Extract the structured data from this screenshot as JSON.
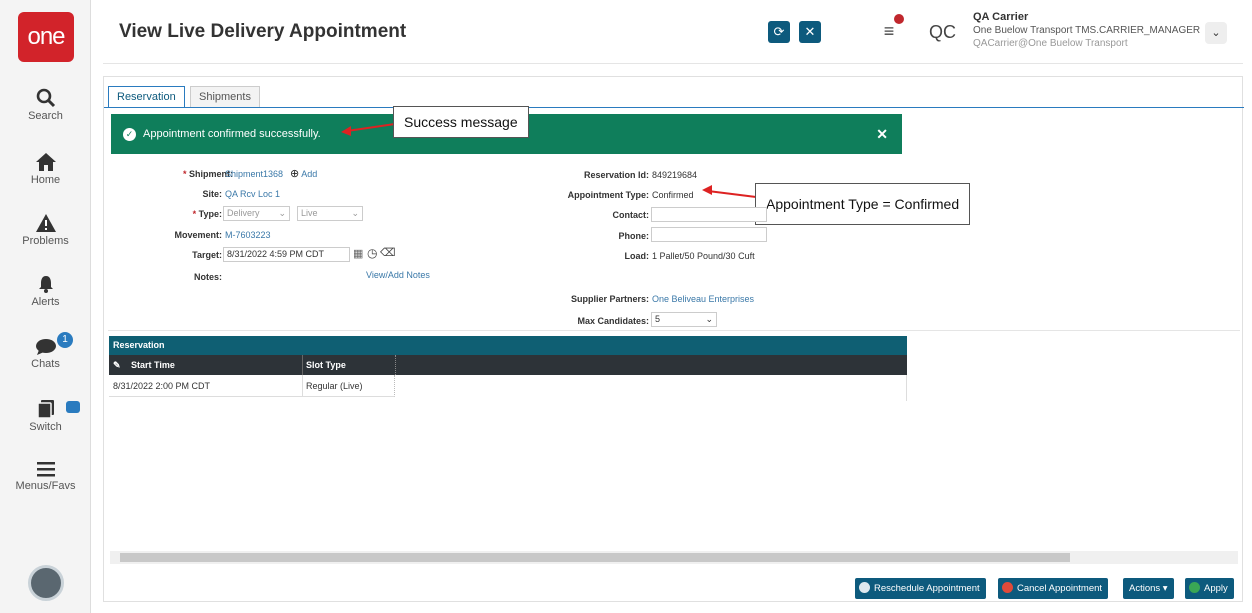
{
  "sidebar": {
    "logo": "one",
    "items": [
      {
        "label": "Search",
        "icon": "search-icon"
      },
      {
        "label": "Home",
        "icon": "home-icon"
      },
      {
        "label": "Problems",
        "icon": "warning-icon"
      },
      {
        "label": "Alerts",
        "icon": "bell-icon"
      },
      {
        "label": "Chats",
        "icon": "chat-icon",
        "badge": "1"
      },
      {
        "label": "Switch",
        "icon": "switch-icon"
      },
      {
        "label": "Menus/Favs",
        "icon": "menu-icon"
      }
    ]
  },
  "header": {
    "title": "View Live Delivery Appointment",
    "user_initials": "QC",
    "user_name": "QA Carrier",
    "user_role": "One Buelow Transport TMS.CARRIER_MANAGER",
    "user_email": "QACarrier@One Buelow Transport"
  },
  "tabs": [
    "Reservation",
    "Shipments"
  ],
  "success_message": "Appointment confirmed successfully.",
  "callouts": {
    "success": "Success message",
    "appt_type": "Appointment Type = Confirmed"
  },
  "form": {
    "shipment_label": "Shipment:",
    "shipment_value": "Shipment1368",
    "add_label": "Add",
    "site_label": "Site:",
    "site_value": "QA Rcv Loc 1",
    "type_label": "Type:",
    "type_value": "Delivery",
    "type_value2": "Live",
    "movement_label": "Movement:",
    "movement_value": "M-7603223",
    "target_label": "Target:",
    "target_value": "8/31/2022 4:59 PM CDT",
    "notes_label": "Notes:",
    "notes_link": "View/Add Notes",
    "reservation_id_label": "Reservation Id:",
    "reservation_id_value": "849219684",
    "appt_type_label": "Appointment Type:",
    "appt_type_value": "Confirmed",
    "contact_label": "Contact:",
    "phone_label": "Phone:",
    "load_label": "Load:",
    "load_value": "1 Pallet/50 Pound/30 Cuft",
    "supplier_label": "Supplier Partners:",
    "supplier_value": "One Beliveau Enterprises",
    "max_candidates_label": "Max Candidates:",
    "max_candidates_value": "5"
  },
  "grid": {
    "title": "Reservation",
    "columns": [
      "Start Time",
      "Slot Type"
    ],
    "rows": [
      [
        "8/31/2022 2:00 PM CDT",
        "Regular (Live)"
      ]
    ]
  },
  "footer": {
    "reschedule": "Reschedule Appointment",
    "cancel": "Cancel Appointment",
    "actions": "Actions",
    "apply": "Apply"
  }
}
